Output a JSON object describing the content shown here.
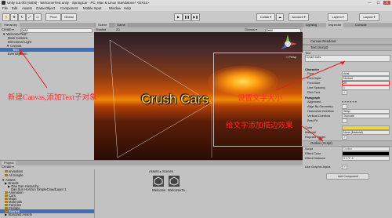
{
  "window": {
    "title": "Unity 5.5.0f3 (64bit) - WelcomeTest.unity - SpringCar - PC, Mac & Linux Standalone* <DX11>",
    "controls": [
      "—",
      "☐",
      "✕"
    ]
  },
  "menu": [
    "File",
    "Edit",
    "Assets",
    "GameObject",
    "Component",
    "Mobile Input",
    "Window",
    "Help"
  ],
  "toolbar": {
    "pivot": "Pivot",
    "global": "Global",
    "play_icons": [
      "▶",
      "❚❚",
      "▶❚"
    ],
    "collab": "Collab ▾",
    "account": "Account ▾",
    "layers": "Layers ▾",
    "layout": "Layout ▾"
  },
  "hierarchy": {
    "tab": "Hierarchy",
    "create": "Create ▾",
    "search_placeholder": "Q▾All",
    "items": [
      {
        "label": "▼ WelcomeTest*",
        "indent": 1,
        "selected": false
      },
      {
        "label": "Main Camera",
        "indent": 2,
        "selected": false
      },
      {
        "label": "Directional Light",
        "indent": 2,
        "selected": false
      },
      {
        "label": "▼ Canvas",
        "indent": 2,
        "selected": false
      },
      {
        "label": "Text",
        "indent": 3,
        "selected": true
      },
      {
        "label": "EventSystem",
        "indent": 2,
        "selected": false
      }
    ]
  },
  "scene": {
    "tabs": [
      "Scene",
      "Game"
    ],
    "shaded": "Shaded",
    "mode2d": "2D",
    "gizmos": "Gizmos ▾",
    "search": "Q▾All",
    "persp": "< Persp",
    "text": "Crush Cars"
  },
  "inspector": {
    "tabs": [
      "Lighting",
      "Inspector",
      "Console"
    ],
    "canvas_renderer": "Canvas Renderer",
    "text_component": "Text (Script)",
    "text_label": "Text",
    "text_value": "Crush Cars",
    "character_header": "Character",
    "character_fields": [
      {
        "label": "Font",
        "value": "Arial"
      },
      {
        "label": "Font Style",
        "value": "Normal"
      },
      {
        "label": "Font Size",
        "value": "29"
      },
      {
        "label": "Line Spacing",
        "value": "1"
      },
      {
        "label": "Rich Text",
        "value": "✓"
      }
    ],
    "paragraph_header": "Paragraph",
    "paragraph_fields": [
      {
        "label": "Alignment",
        "value": "≡ ≡ ≡  ≡ ≡ ≡"
      },
      {
        "label": "Align By Geometry",
        "value": ""
      },
      {
        "label": "Horizontal Overflow",
        "value": "Wrap"
      },
      {
        "label": "Vertical Overflow",
        "value": "Truncate"
      },
      {
        "label": "Best Fit",
        "value": ""
      }
    ],
    "color_label": "Color",
    "color_value": "#f2d24a",
    "material_label": "Material",
    "material_value": "None (Material)",
    "raycast_label": "Raycast Target",
    "outline_component": "Outline (Script)",
    "outline_script_label": "Script",
    "outline_script_value": "Outline",
    "effect_color_label": "Effect Color",
    "effect_color_value": "#000000",
    "effect_distance_label": "Effect Distance",
    "effect_distance_value": "X 1    Y -1",
    "graphic_alpha_label": "Use Graphic Alpha",
    "add_component": "Add Component"
  },
  "project": {
    "tab": "Project",
    "create": "Create ▾",
    "top_items": [
      "animation",
      "All Simple"
    ],
    "tree": [
      {
        "label": "▼ Assets",
        "indent": 1
      },
      {
        "label": "▶ Brands",
        "indent": 2
      },
      {
        "label": "▶ Das Sun Hierarchy",
        "indent": 3
      },
      {
        "label": "Das Sun Horizon SimpleCloudLayer 1",
        "indent": 4
      },
      {
        "label": "Animation",
        "indent": 2
      },
      {
        "label": "Cars",
        "indent": 2
      },
      {
        "label": "Maps",
        "indent": 2
      },
      {
        "label": "Materials",
        "indent": 2
      },
      {
        "label": "Particles",
        "indent": 2
      },
      {
        "label": "Prefabs",
        "indent": 2
      },
      {
        "label": "Scenes",
        "indent": 2
      },
      {
        "label": "▶ Standard Assets",
        "indent": 2
      }
    ],
    "breadcrumb": "Assets ▸ Scenes",
    "assets": [
      "Welcome",
      "WelcomeTe..."
    ]
  },
  "annotations": [
    {
      "text": "新建Canvas,添加Text子对象"
    },
    {
      "text": "设置文字大小"
    },
    {
      "text": "给文字添加描边效果"
    }
  ]
}
